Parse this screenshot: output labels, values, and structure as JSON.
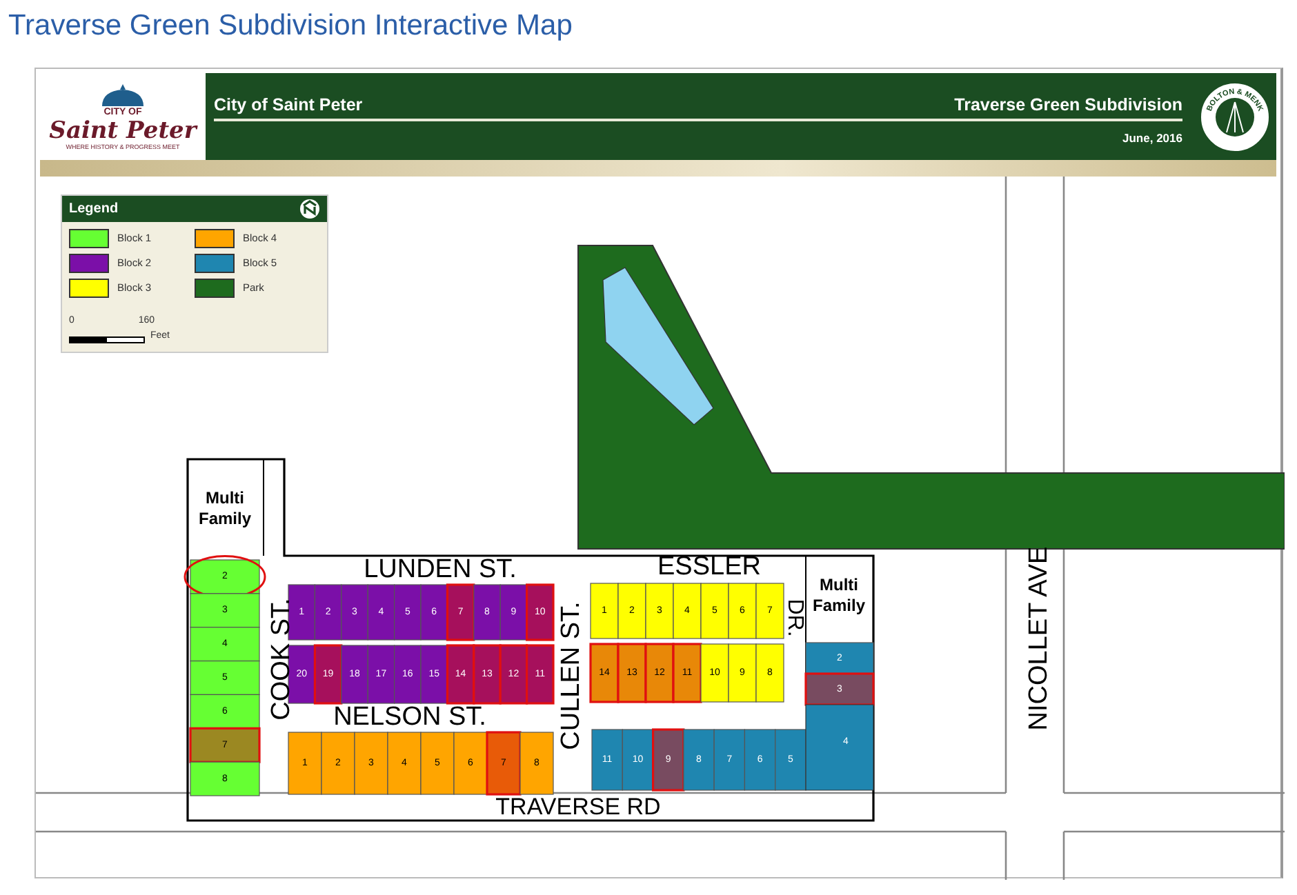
{
  "page_title": "Traverse Green Subdivision Interactive Map",
  "map": {
    "header": {
      "org_logo": {
        "line1": "CITY OF",
        "line2": "Saint Peter",
        "tagline": "WHERE HISTORY & PROGRESS MEET"
      },
      "left_title": "City of Saint Peter",
      "right_title": "Traverse Green Subdivision",
      "date": "June, 2016",
      "firm_logo": {
        "text": "BOLTON & MENK"
      }
    },
    "legend": {
      "title": "Legend",
      "items": [
        {
          "label": "Block 1",
          "color": "#66ff33"
        },
        {
          "label": "Block 4",
          "color": "#ffa500"
        },
        {
          "label": "Block 2",
          "color": "#7b0fa8"
        },
        {
          "label": "Block 5",
          "color": "#1f86b0"
        },
        {
          "label": "Block 3",
          "color": "#ffff00"
        },
        {
          "label": "Park",
          "color": "#1e6b1e"
        }
      ],
      "scale": {
        "start": "0",
        "end": "160",
        "unit": "Feet"
      }
    },
    "streets": [
      {
        "name": "LUNDEN ST."
      },
      {
        "name": "ESSLER"
      },
      {
        "name": "DR."
      },
      {
        "name": "COOK ST."
      },
      {
        "name": "NELSON ST."
      },
      {
        "name": "CULLEN ST."
      },
      {
        "name": "TRAVERSE RD"
      },
      {
        "name": "NICOLLET AVE"
      }
    ],
    "areas": [
      {
        "lines": [
          "Multi",
          "Family"
        ]
      },
      {
        "lines": [
          "Multi",
          "Family"
        ]
      }
    ],
    "blocks": [
      {
        "color": "#66ff33",
        "lots": [
          {
            "number": "2",
            "sold": false,
            "circled": true
          },
          {
            "number": "3",
            "sold": false,
            "circled": false
          },
          {
            "number": "4",
            "sold": false,
            "circled": false
          },
          {
            "number": "5",
            "sold": false,
            "circled": false
          },
          {
            "number": "6",
            "sold": false,
            "circled": false
          },
          {
            "number": "7",
            "sold": true,
            "circled": false
          },
          {
            "number": "8",
            "sold": false,
            "circled": false
          }
        ]
      },
      {
        "color": "#7b0fa8",
        "lots": [
          {
            "number": "1",
            "sold": false,
            "circled": false
          },
          {
            "number": "2",
            "sold": false,
            "circled": false
          },
          {
            "number": "3",
            "sold": false,
            "circled": false
          },
          {
            "number": "4",
            "sold": false,
            "circled": false
          },
          {
            "number": "5",
            "sold": false,
            "circled": false
          },
          {
            "number": "6",
            "sold": false,
            "circled": false
          },
          {
            "number": "7",
            "sold": true,
            "circled": false
          },
          {
            "number": "8",
            "sold": false,
            "circled": false
          },
          {
            "number": "9",
            "sold": false,
            "circled": false
          },
          {
            "number": "10",
            "sold": true,
            "circled": false
          },
          {
            "number": "20",
            "sold": false,
            "circled": false
          },
          {
            "number": "19",
            "sold": true,
            "circled": false
          },
          {
            "number": "18",
            "sold": false,
            "circled": false
          },
          {
            "number": "17",
            "sold": false,
            "circled": false
          },
          {
            "number": "16",
            "sold": false,
            "circled": false
          },
          {
            "number": "15",
            "sold": false,
            "circled": false
          },
          {
            "number": "14",
            "sold": true,
            "circled": false
          },
          {
            "number": "13",
            "sold": true,
            "circled": false
          },
          {
            "number": "12",
            "sold": true,
            "circled": false
          },
          {
            "number": "11",
            "sold": true,
            "circled": false
          }
        ]
      },
      {
        "color": "#ffff00",
        "lots": [
          {
            "number": "1",
            "sold": false,
            "circled": false
          },
          {
            "number": "2",
            "sold": false,
            "circled": false
          },
          {
            "number": "3",
            "sold": false,
            "circled": false
          },
          {
            "number": "4",
            "sold": false,
            "circled": false
          },
          {
            "number": "5",
            "sold": false,
            "circled": false
          },
          {
            "number": "6",
            "sold": false,
            "circled": false
          },
          {
            "number": "7",
            "sold": false,
            "circled": false
          },
          {
            "number": "14",
            "sold": true,
            "circled": false
          },
          {
            "number": "13",
            "sold": true,
            "circled": false
          },
          {
            "number": "12",
            "sold": true,
            "circled": false
          },
          {
            "number": "11",
            "sold": true,
            "circled": false
          },
          {
            "number": "10",
            "sold": false,
            "circled": false
          },
          {
            "number": "9",
            "sold": false,
            "circled": false
          },
          {
            "number": "8",
            "sold": false,
            "circled": false
          }
        ]
      },
      {
        "color": "#ffa500",
        "lots": [
          {
            "number": "1",
            "sold": false,
            "circled": false
          },
          {
            "number": "2",
            "sold": false,
            "circled": false
          },
          {
            "number": "3",
            "sold": false,
            "circled": false
          },
          {
            "number": "4",
            "sold": false,
            "circled": false
          },
          {
            "number": "5",
            "sold": false,
            "circled": false
          },
          {
            "number": "6",
            "sold": false,
            "circled": false
          },
          {
            "number": "7",
            "sold": true,
            "circled": false
          },
          {
            "number": "8",
            "sold": false,
            "circled": false
          }
        ]
      },
      {
        "color": "#1f86b0",
        "lots": [
          {
            "number": "2",
            "sold": false,
            "circled": false
          },
          {
            "number": "3",
            "sold": true,
            "circled": false
          },
          {
            "number": "11",
            "sold": false,
            "circled": false
          },
          {
            "number": "10",
            "sold": false,
            "circled": false
          },
          {
            "number": "9",
            "sold": true,
            "circled": false
          },
          {
            "number": "8",
            "sold": false,
            "circled": false
          },
          {
            "number": "7",
            "sold": false,
            "circled": false
          },
          {
            "number": "6",
            "sold": false,
            "circled": false
          },
          {
            "number": "5",
            "sold": false,
            "circled": false
          },
          {
            "number": "4",
            "sold": false,
            "circled": false
          }
        ]
      }
    ]
  }
}
